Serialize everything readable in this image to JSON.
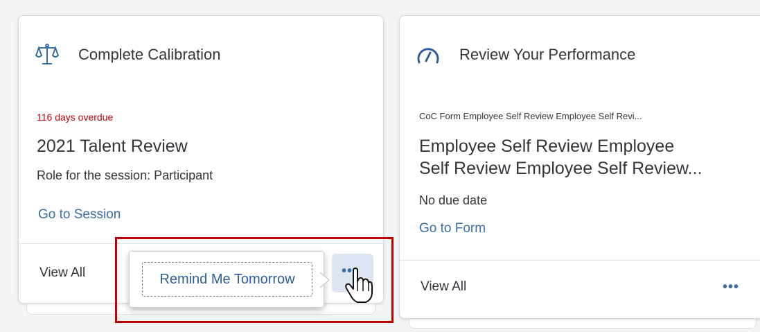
{
  "cards": [
    {
      "title": "Complete Calibration",
      "icon": "scale-icon",
      "status": "116 days overdue",
      "item_title": "2021 Talent Review",
      "role": "Role for the session: Participant",
      "link": "Go to Session",
      "footer_link": "View All"
    },
    {
      "title": "Review Your Performance",
      "icon": "gauge-icon",
      "subtitle": "CoC Form Employee Self Review Employee Self Revi...",
      "item_title_line1": "Employee Self Review Employee",
      "item_title_line2": "Self Review Employee Self Review...",
      "due": "No due date",
      "link": "Go to Form",
      "footer_link": "View All",
      "more": "•••"
    }
  ],
  "popover": {
    "action": "Remind Me Tomorrow"
  },
  "overflow_button": "•••",
  "colors": {
    "accent": "#3a6ea5",
    "overdue": "#bb0000",
    "highlight": "#bf0000"
  }
}
